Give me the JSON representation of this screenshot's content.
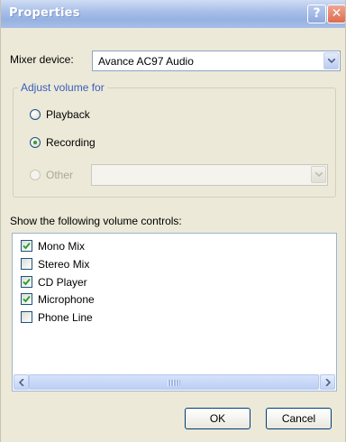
{
  "window": {
    "title": "Properties"
  },
  "titlebar": {
    "help_label": "?",
    "close_label": "✕"
  },
  "mixer": {
    "label": "Mixer device:",
    "value": "Avance AC97 Audio"
  },
  "adjust_group": {
    "legend": "Adjust volume for",
    "options": [
      {
        "label": "Playback",
        "selected": false,
        "enabled": true
      },
      {
        "label": "Recording",
        "selected": true,
        "enabled": true
      },
      {
        "label": "Other",
        "selected": false,
        "enabled": false
      }
    ],
    "other_combo_value": ""
  },
  "controls": {
    "label": "Show the following volume controls:",
    "items": [
      {
        "label": "Mono Mix",
        "checked": true
      },
      {
        "label": "Stereo Mix",
        "checked": false
      },
      {
        "label": "CD Player",
        "checked": true
      },
      {
        "label": "Microphone",
        "checked": true
      },
      {
        "label": "Phone Line",
        "checked": false
      }
    ]
  },
  "buttons": {
    "ok": "OK",
    "cancel": "Cancel"
  },
  "colors": {
    "title_bar": "#a9c0e8",
    "dialog_bg": "#ece9d8",
    "group_legend": "#3a5dba",
    "radio_dot": "#3a9a3a",
    "check_mark": "#21a121"
  }
}
